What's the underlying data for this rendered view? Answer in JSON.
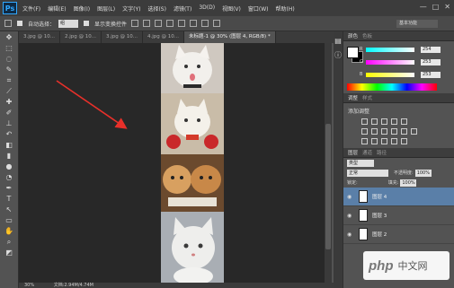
{
  "app": {
    "logo": "Ps"
  },
  "menu": [
    "文件(F)",
    "编辑(E)",
    "图像(I)",
    "图层(L)",
    "文字(Y)",
    "选择(S)",
    "滤镜(T)",
    "3D(D)",
    "视图(V)",
    "窗口(W)",
    "帮助(H)"
  ],
  "window_controls": [
    "—",
    "□",
    "✕"
  ],
  "options": {
    "auto_select": "自动选择：",
    "auto_select_value": "组",
    "show_transform": "显示变换控件"
  },
  "workspace": "基本功能",
  "tabs": [
    {
      "label": "3.jpg @ 10..."
    },
    {
      "label": "2.jpg @ 10..."
    },
    {
      "label": "3.jpg @ 10..."
    },
    {
      "label": "4.jpg @ 10..."
    },
    {
      "label": "未标题-1 @ 30% (图层 4, RGB/8) *"
    }
  ],
  "status": {
    "zoom": "30%",
    "doc": "文档:2.94M/4.74M"
  },
  "panels": {
    "color_tabs": [
      "颜色",
      "色板"
    ],
    "rgb": [
      {
        "label": "R",
        "value": "254"
      },
      {
        "label": "G",
        "value": "253"
      },
      {
        "label": "B",
        "value": "253"
      }
    ],
    "adj_tabs": [
      "调整",
      "样式"
    ],
    "adj_title": "添加调整",
    "layer_tabs": [
      "图层",
      "通道",
      "路径"
    ],
    "kind": "类型",
    "blend": "正常",
    "opacity_label": "不透明度:",
    "opacity": "100%",
    "lock_label": "锁定:",
    "fill_label": "填充:",
    "fill": "100%",
    "layers": [
      {
        "name": "图层 4",
        "selected": true
      },
      {
        "name": "图层 3",
        "selected": false
      },
      {
        "name": "图层 2",
        "selected": false
      }
    ]
  },
  "watermark": {
    "logo": "php",
    "text": "中文网"
  }
}
